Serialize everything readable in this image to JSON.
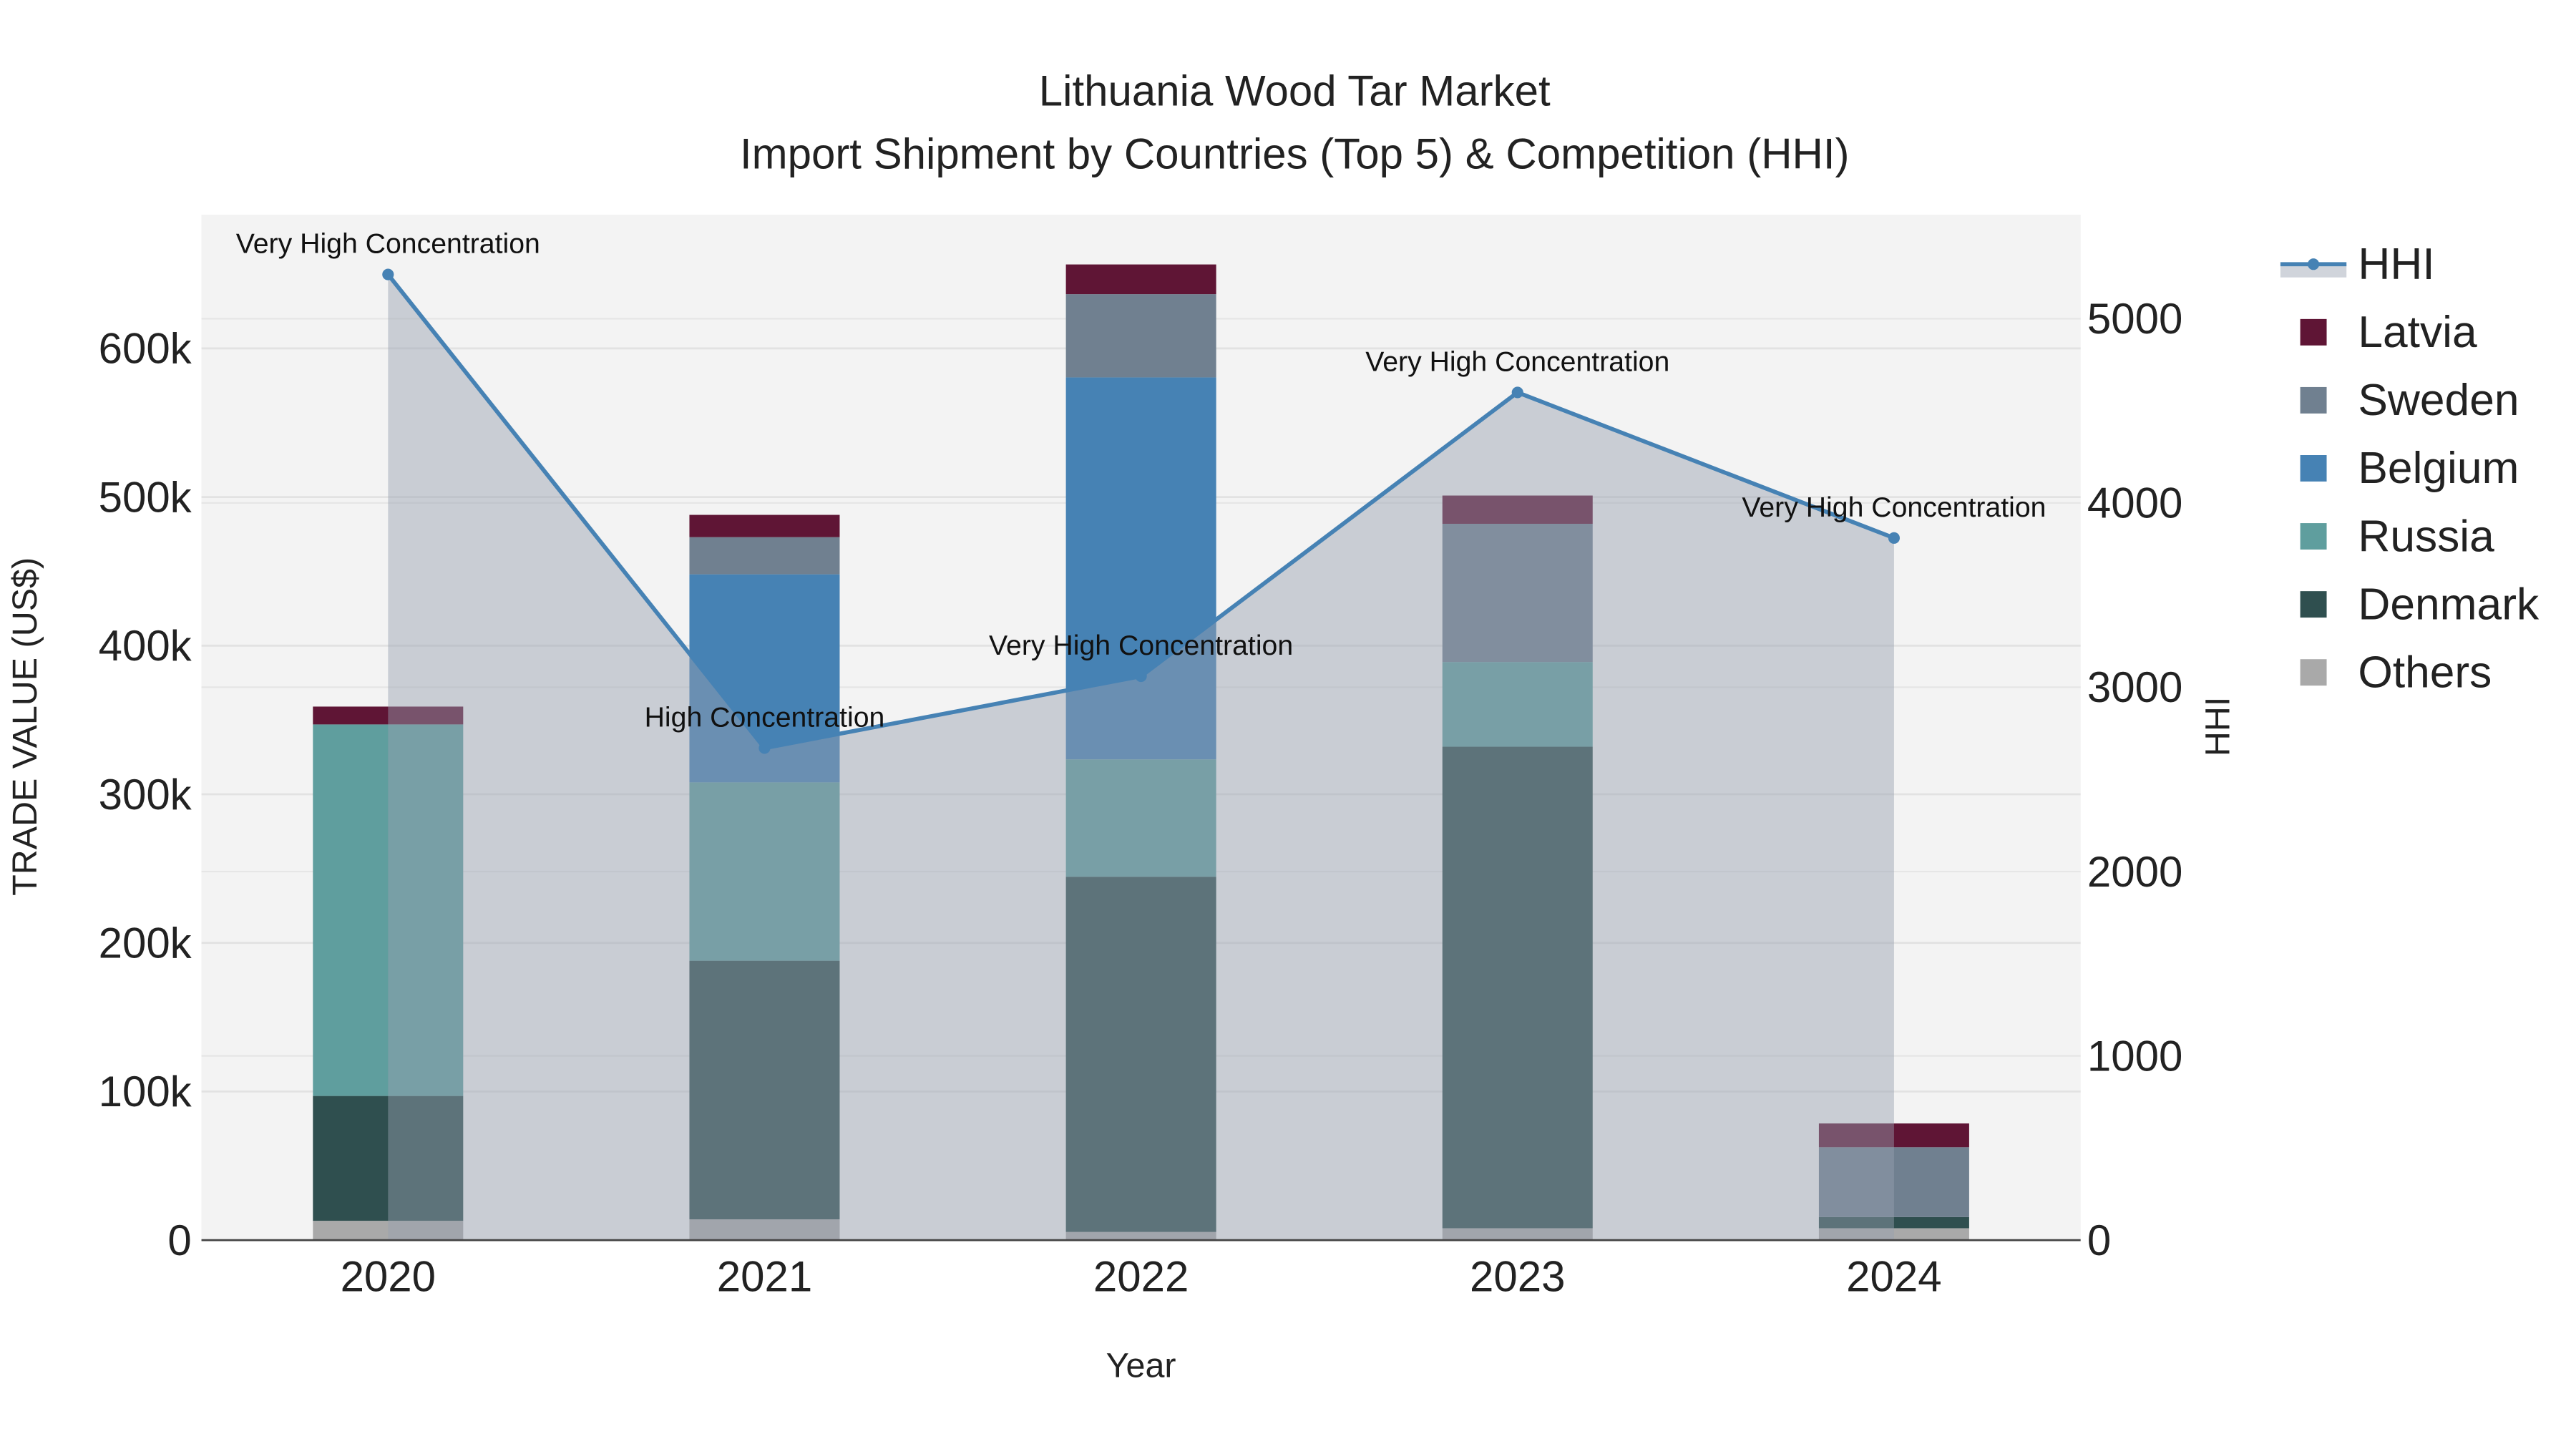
{
  "chart_data": {
    "type": "bar",
    "title": "Lithuania Wood Tar Market",
    "subtitle": "Import Shipment by Countries (Top 5) & Competition (HHI)",
    "xlabel": "Year",
    "ylabel": "TRADE VALUE (US$)",
    "y2label": "HHI",
    "categories": [
      "2020",
      "2021",
      "2022",
      "2023",
      "2024"
    ],
    "ylim": [
      0,
      690000
    ],
    "y2lim": [
      0,
      5560
    ],
    "yticks": [
      0,
      100000,
      200000,
      300000,
      400000,
      500000,
      600000
    ],
    "ytick_labels": [
      "0",
      "100k",
      "200k",
      "300k",
      "400k",
      "500k",
      "600k"
    ],
    "y2ticks": [
      0,
      1000,
      2000,
      3000,
      4000,
      5000
    ],
    "y2tick_labels": [
      "0",
      "1000",
      "2000",
      "3000",
      "4000",
      "5000"
    ],
    "stacked": true,
    "series": [
      {
        "name": "Others",
        "color": "#a9a9a9",
        "values": [
          13000,
          14000,
          5500,
          8000,
          8000
        ]
      },
      {
        "name": "Denmark",
        "color": "#2f4f4f",
        "values": [
          84000,
          174000,
          239000,
          324000,
          7500
        ]
      },
      {
        "name": "Russia",
        "color": "#5f9e9e",
        "values": [
          250000,
          120000,
          79000,
          57000,
          0
        ]
      },
      {
        "name": "Belgium",
        "color": "#4682b4",
        "values": [
          0,
          140000,
          257000,
          0,
          0
        ]
      },
      {
        "name": "Sweden",
        "color": "#708090",
        "values": [
          0,
          25000,
          56000,
          93000,
          47000
        ]
      },
      {
        "name": "Latvia",
        "color": "#5f1535",
        "values": [
          12000,
          15000,
          20000,
          19000,
          16000
        ]
      }
    ],
    "line": {
      "name": "HHI",
      "color": "#4682b4",
      "axis": "right",
      "values": [
        5240,
        2670,
        3060,
        4600,
        3810
      ],
      "annotations": [
        "Very High Concentration",
        "High Concentration",
        "Very High Concentration",
        "Very High Concentration",
        "Very High Concentration"
      ]
    },
    "legend_order": [
      "HHI",
      "Latvia",
      "Sweden",
      "Belgium",
      "Russia",
      "Denmark",
      "Others"
    ],
    "legend_position": "right",
    "grid": true
  }
}
